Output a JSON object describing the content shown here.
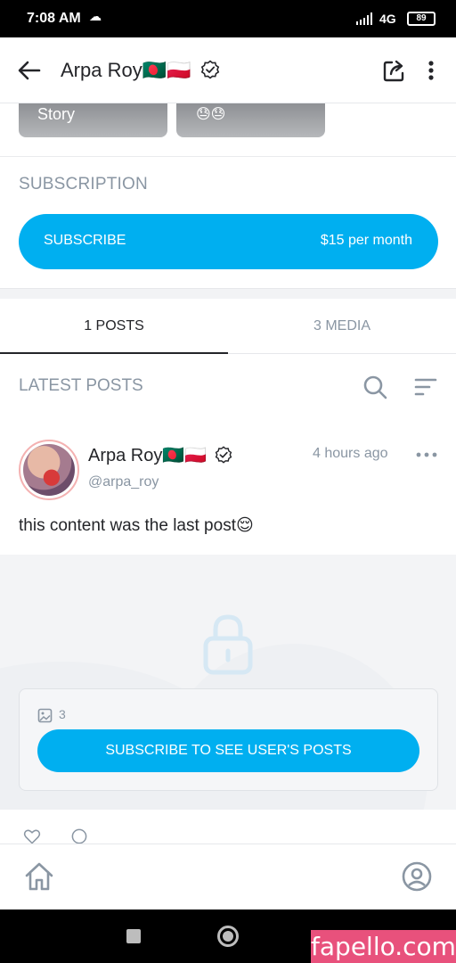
{
  "status_bar": {
    "time": "7:08 AM",
    "network": "4G",
    "battery": "89",
    "icons": [
      "cloud-icon",
      "signal-icon",
      "battery-icon"
    ]
  },
  "header": {
    "title": "Arpa Roy🇧🇩🇵🇱",
    "icons": [
      "back-arrow-icon",
      "verified-badge-icon",
      "share-icon",
      "more-vertical-icon"
    ]
  },
  "stories": [
    {
      "label": "Story"
    },
    {
      "label": "😓😓"
    }
  ],
  "subscription": {
    "heading": "SUBSCRIPTION",
    "button_label": "SUBSCRIBE",
    "price": "$15 per month"
  },
  "tabs": [
    {
      "label": "1 POSTS",
      "active": true
    },
    {
      "label": "3 MEDIA",
      "active": false
    }
  ],
  "posts_section": {
    "heading": "LATEST POSTS",
    "icons": [
      "search-icon",
      "sort-icon"
    ]
  },
  "post": {
    "author_name": "Arpa Roy🇧🇩🇵🇱",
    "handle": "@arpa_roy",
    "time_ago": "4 hours ago",
    "text": "this content was the last post😌",
    "media_count": "3",
    "locked_button_label": "SUBSCRIBE TO SEE USER'S POSTS",
    "icons": [
      "lock-icon",
      "image-icon",
      "like-icon",
      "comment-icon",
      "more-horizontal-icon"
    ]
  },
  "bottom_nav": {
    "icons": [
      "home-icon",
      "profile-icon"
    ]
  },
  "watermark": "fapello.com",
  "colors": {
    "accent": "#00aff0",
    "muted": "#8a96a3",
    "text": "#242529",
    "watermark_bg": "#e8517c"
  }
}
